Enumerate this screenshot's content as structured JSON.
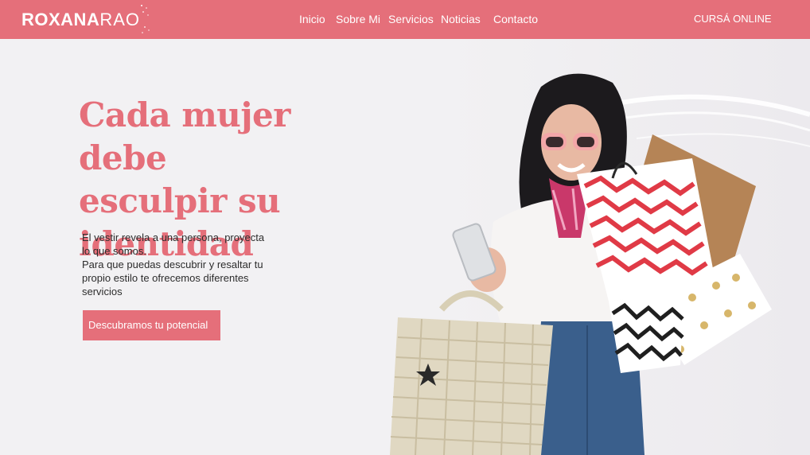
{
  "brand": {
    "name_bold": "ROXANA",
    "name_light": "RAO"
  },
  "nav": {
    "items": [
      {
        "label": "Inicio"
      },
      {
        "label": "Sobre Mi"
      },
      {
        "label": "Servicios"
      },
      {
        "label": "Noticias"
      },
      {
        "label": "Contacto"
      }
    ],
    "cta_label": "CURSÁ ONLINE"
  },
  "hero": {
    "headline_lines": [
      "Cada mujer debe",
      "esculpir su",
      "identidad"
    ],
    "paragraph_lines": [
      "El vestir revela a una persona, proyecta",
      "lo que somos.",
      "Para que puedas descubrir y resaltar tu",
      "propio estilo  te ofrecemos  diferentes",
      "servicios"
    ],
    "button_label": "Descubramos tu potencial"
  },
  "colors": {
    "brand": "#e56f7a",
    "background": "#f1f0f2",
    "text": "#2c2c2c"
  },
  "icons": [
    "logo-sparkle-icon"
  ]
}
